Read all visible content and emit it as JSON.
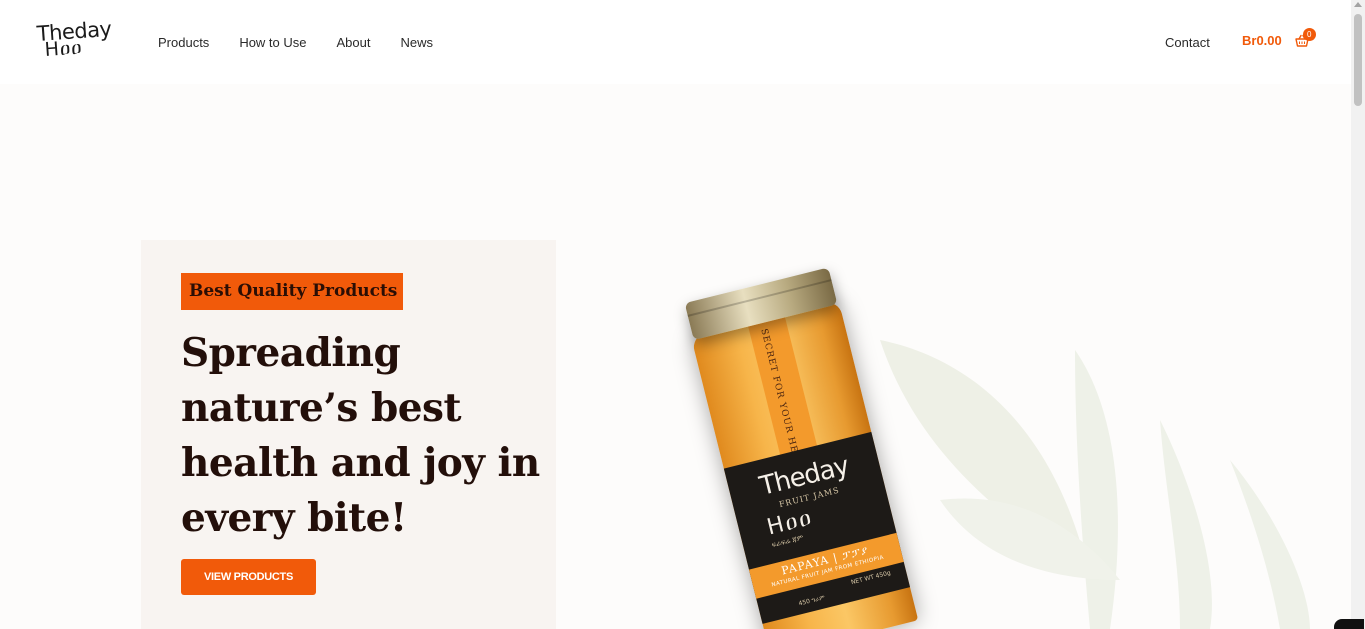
{
  "header": {
    "logo": {
      "line1": "Theday",
      "line2": "Hዐዐ"
    },
    "nav": [
      {
        "label": "Products"
      },
      {
        "label": "How to Use"
      },
      {
        "label": "About"
      },
      {
        "label": "News"
      }
    ],
    "contact_label": "Contact",
    "cart": {
      "amount": "Br0.00",
      "count": "0",
      "icon": "basket-icon"
    }
  },
  "hero": {
    "badge": "Best Quality Products",
    "headline": "Spreading nature’s best health and joy in every bite!",
    "cta_label": "VIEW PRODUCTS"
  },
  "product_image": {
    "strip_text": "SECRET FOR YOUR HEALTH",
    "brand": "Theday",
    "sub": "FRUIT JAMS",
    "brand2": "Hዐዐ",
    "amharic": "ፍራፍሬ ጃም",
    "band_title": "PAPAYA | ፓፓያ",
    "band_sub": "NATURAL FRUIT JAM FROM ETHIOPIA",
    "net_wt": "NET WT 450g",
    "amh_wt": "450 ግራም"
  },
  "colors": {
    "accent": "#f15a0a",
    "headline": "#230f0a",
    "card_bg": "#f8f4f1",
    "page_bg": "#fdfcfb"
  }
}
